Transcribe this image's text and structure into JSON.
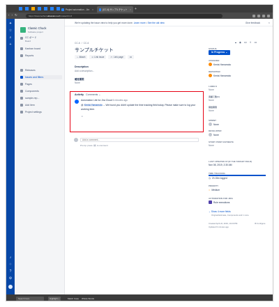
{
  "browser": {
    "tabs": [
      {
        "label": "Project automation - Jira"
      },
      {
        "label": "[CC-6] サンプルチケット - Jira"
      }
    ],
    "url_prefix": "https://",
    "url_host": "classmethod-",
    "url_domain": "atlassian.net",
    "url_path": "/browse/CC-6"
  },
  "banner": {
    "text": "We're updating the issue view to help you get more done.",
    "learn_more": "Learn more",
    "see_old_view": "See the old view",
    "feedback": "Give feedback"
  },
  "sidebar": {
    "project_name": "Classic Chuck",
    "project_type": "Software project",
    "board_name": "CC ボード",
    "board_type": "Board",
    "items": [
      {
        "label": "Kanban board"
      },
      {
        "label": "Reports"
      },
      {
        "label": "Releases"
      },
      {
        "label": "Issues and filters"
      },
      {
        "label": "Pages"
      },
      {
        "label": "Components"
      },
      {
        "label": "sample-rep..."
      },
      {
        "label": "Add item"
      },
      {
        "label": "Project settings"
      }
    ]
  },
  "issue": {
    "breadcrumb": [
      "CC-6",
      "CC-6"
    ],
    "summary": "サンプルチケット",
    "actions": {
      "attach": "Attach",
      "link_issue": "Link issue",
      "link_page": "Link page"
    },
    "description_heading": "Description",
    "description_placeholder": "Add a description...",
    "date_heading": "確定期限",
    "date_value": "None"
  },
  "activity": {
    "heading": "Activity",
    "filter": "Comments",
    "comment": {
      "author": "Automation Lite for Jira Cloud",
      "time": "6 minutes ago",
      "mention": "Kenta Yamamoto",
      "body": " -- We found you didn't update the time tracking field today. Please make sure to log your working time."
    },
    "add_comment_placeholder": "Add a comment...",
    "pro_tip_prefix": "Pro tip: press",
    "pro_tip_key": "M",
    "pro_tip_suffix": "to comment"
  },
  "details": {
    "status_label": "STATUS",
    "status": "In Progress",
    "fields": [
      {
        "label": "ASSIGNEE",
        "value": "Kenta Yamamoto"
      },
      {
        "label": "REPORTER",
        "value": "Kenta Yamamoto"
      },
      {
        "label": "LABELS",
        "value": "None"
      },
      {
        "label": "実績工数(h)",
        "value": "None"
      },
      {
        "label": "開始期限",
        "value": "None"
      },
      {
        "label": "SPRINT",
        "value": "None"
      },
      {
        "label": "DEVELOPER",
        "value": "None"
      },
      {
        "label": "STORY POINT ESTIMATE",
        "value": "None"
      },
      {
        "label": "LAST UPDATED AT (IF THE TARGET FIELD)",
        "value": "Nov 08, 2019, 2:30 AM"
      },
      {
        "label": "TIME TRACKING",
        "value": "2h 15m logged"
      },
      {
        "label": "PRIORITY",
        "value": "Medium"
      },
      {
        "label": "AUTOMATION FOR JIRA",
        "value": "Rule executions"
      }
    ],
    "show_more": "Show 4 more fields",
    "show_more_sub": "Original Estimate, Components and 1 more",
    "created": "Created April 22, 2019, 10:20 PM",
    "updated": "Updated 6 minutes ago",
    "configure": "Configure"
  },
  "taskbar": {
    "search": "Search here",
    "items": [
      {
        "label": "Highlight +"
      },
      {
        "label": "Match Case"
      },
      {
        "label": "Whole Words"
      }
    ]
  },
  "colors": {
    "global_nav": "#0747a6",
    "accent": "#0052cc",
    "highlight_border": "#e60012"
  }
}
